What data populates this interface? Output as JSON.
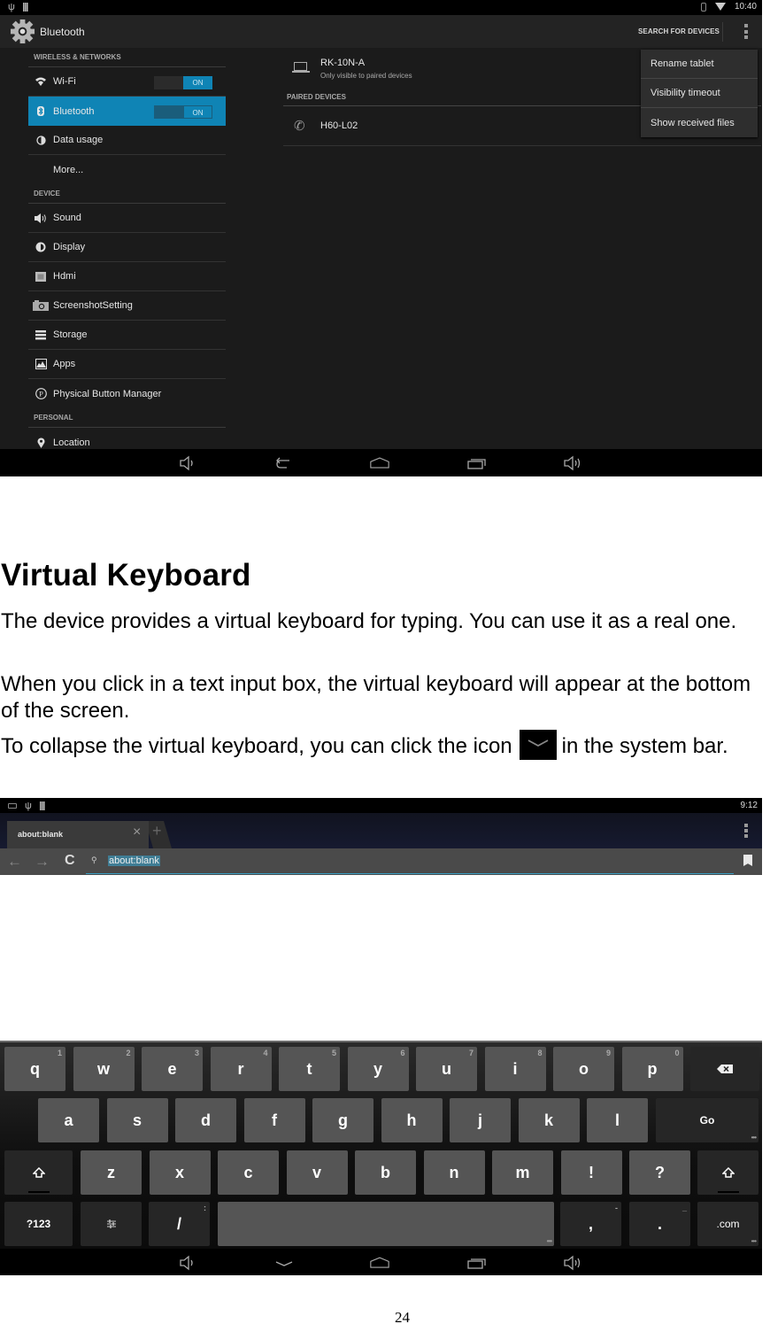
{
  "settings_screen": {
    "status_bar": {
      "time": "10:40",
      "icons_left": [
        "usb-icon",
        "battery-icon"
      ],
      "icons_right": [
        "bluetooth-icon",
        "wifi-icon"
      ]
    },
    "action_bar": {
      "title": "Bluetooth",
      "search_label": "SEARCH FOR DEVICES"
    },
    "sections": [
      {
        "header": "WIRELESS & NETWORKS",
        "items": [
          {
            "label": "Wi-Fi",
            "icon": "wifi-icon",
            "toggle": "ON"
          },
          {
            "label": "Bluetooth",
            "icon": "bluetooth-icon",
            "toggle": "ON",
            "active": true
          },
          {
            "label": "Data usage",
            "icon": "data-usage-icon"
          },
          {
            "label": "More...",
            "icon": ""
          }
        ]
      },
      {
        "header": "DEVICE",
        "items": [
          {
            "label": "Sound",
            "icon": "sound-icon"
          },
          {
            "label": "Display",
            "icon": "display-icon"
          },
          {
            "label": "Hdmi",
            "icon": "hdmi-icon"
          },
          {
            "label": "ScreenshotSetting",
            "icon": "camera-icon"
          },
          {
            "label": "Storage",
            "icon": "storage-icon"
          },
          {
            "label": "Apps",
            "icon": "apps-icon"
          },
          {
            "label": "Physical Button Manager",
            "icon": "p-circle-icon"
          }
        ]
      },
      {
        "header": "PERSONAL",
        "items": [
          {
            "label": "Location",
            "icon": "location-icon"
          }
        ]
      }
    ],
    "this_device": {
      "name": "RK-10N-A",
      "subtitle": "Only visible to paired devices"
    },
    "paired_header": "PAIRED DEVICES",
    "paired_devices": [
      {
        "name": "H60-L02"
      }
    ],
    "overflow_menu": [
      "Rename tablet",
      "Visibility timeout",
      "Show received files"
    ]
  },
  "document": {
    "heading": "Virtual Keyboard",
    "paragraph1": "The device provides a virtual keyboard for typing. You can use it as a real one.",
    "paragraph2": "When you click in a text input box, the virtual keyboard will appear at the bottom of the screen.",
    "paragraph3_before": "To collapse the virtual keyboard, you can click the icon",
    "paragraph3_after": "in the system bar.",
    "page_number": "24"
  },
  "browser_screen": {
    "status_bar": {
      "time": "9:12"
    },
    "tab_title": "about:blank",
    "url": "about:blank"
  },
  "keyboard": {
    "row1": [
      {
        "k": "q",
        "h": "1"
      },
      {
        "k": "w",
        "h": "2"
      },
      {
        "k": "e",
        "h": "3"
      },
      {
        "k": "r",
        "h": "4"
      },
      {
        "k": "t",
        "h": "5"
      },
      {
        "k": "y",
        "h": "6"
      },
      {
        "k": "u",
        "h": "7"
      },
      {
        "k": "i",
        "h": "8"
      },
      {
        "k": "o",
        "h": "9"
      },
      {
        "k": "p",
        "h": "0"
      }
    ],
    "row2": [
      "a",
      "s",
      "d",
      "f",
      "g",
      "h",
      "j",
      "k",
      "l"
    ],
    "go_label": "Go",
    "row3": [
      "z",
      "x",
      "c",
      "v",
      "b",
      "n",
      "m",
      "!",
      "?"
    ],
    "symbols_label": "?123",
    "slash_label": "/",
    "slash_hint": ":",
    "comma_label": ",",
    "comma_hint": "-",
    "period_label": ".",
    "period_hint": "_",
    "dotcom_label": ".com"
  }
}
